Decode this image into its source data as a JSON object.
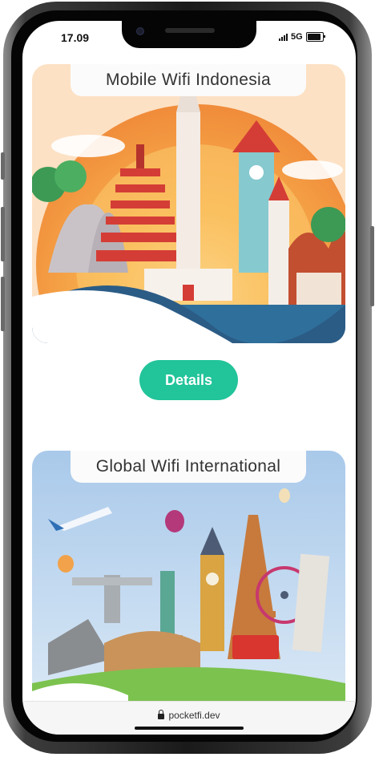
{
  "status_bar": {
    "time": "17.09",
    "network": "5G"
  },
  "cards": [
    {
      "title": "Mobile Wifi Indonesia"
    },
    {
      "title": "Global Wifi International"
    }
  ],
  "details_label": "Details",
  "browser": {
    "url": "pocketfi.dev"
  },
  "colors": {
    "accent": "#22c49a",
    "sky_indonesia": "#f6a04a",
    "sky_global": "#bcd8f0"
  }
}
